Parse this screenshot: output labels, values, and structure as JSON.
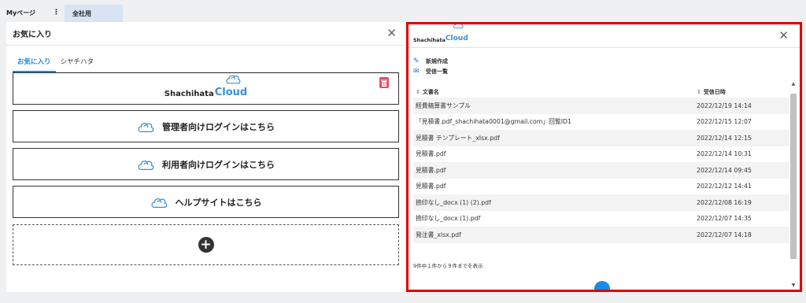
{
  "topbar": {
    "my_page_tab": "Myページ",
    "kebab": "⋮",
    "company_tab": "全社用"
  },
  "left_panel": {
    "title": "お気に入り",
    "close": "✕",
    "tabs": [
      "お気に入り",
      "シヤチハタ"
    ],
    "logo": {
      "brand_text": "Shachihata",
      "brand_cloud": "Cloud"
    },
    "links": [
      "管理者向けログインはこちら",
      "利用者向けログインはこちら",
      "ヘルプサイトはこちら"
    ],
    "add_symbol": "+"
  },
  "right_panel": {
    "logo": {
      "brand_text": "Shachihata",
      "brand_cloud": "Cloud"
    },
    "close": "✕",
    "actions": {
      "new": "新規作成",
      "received": "受信一覧"
    },
    "table": {
      "headers": {
        "name": "文書名",
        "date": "受信日時"
      },
      "rows": [
        {
          "name": "経費精算書サンプル",
          "date": "2022/12/19 14:14"
        },
        {
          "name": "「見積書.pdf_shachihata0001@gmail.com」回覧ID1",
          "date": "2022/12/15 12:07"
        },
        {
          "name": "見積書 テンプレート_xlsx.pdf",
          "date": "2022/12/14 12:15"
        },
        {
          "name": "見積書.pdf",
          "date": "2022/12/14 10:31"
        },
        {
          "name": "見積書.pdf",
          "date": "2022/12/14 09:45"
        },
        {
          "name": "見積書.pdf",
          "date": "2022/12/12 14:41"
        },
        {
          "name": "捺印なし_docx (1) (2).pdf",
          "date": "2022/12/08 16:19"
        },
        {
          "name": "捺印なし_docx (1).pdf",
          "date": "2022/12/07 14:35"
        },
        {
          "name": "発注書_xlsx.pdf",
          "date": "2022/12/07 14:18"
        }
      ]
    },
    "footer": "9件中１件から９件までを表示"
  },
  "colors": {
    "accent": "#1e88e5",
    "highlight_border": "#e00000",
    "cloud_blue": "#3a8fd4",
    "trash": "#e34b6e"
  }
}
